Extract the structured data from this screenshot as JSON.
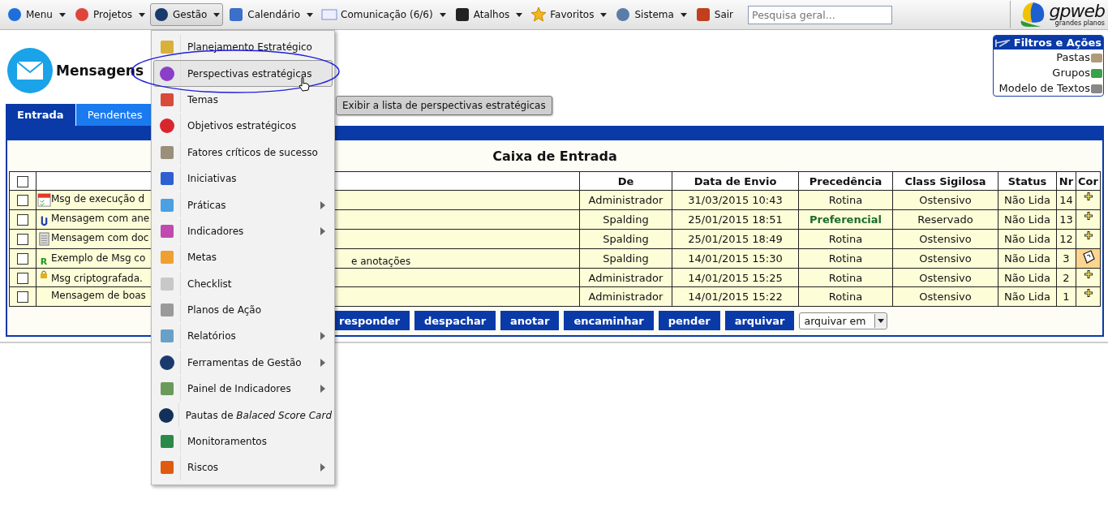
{
  "menu_bar": {
    "items": [
      {
        "label": "Menu",
        "kind": "drop",
        "caret": true,
        "selected": false
      },
      {
        "label": "Projetos",
        "kind": "puzzle",
        "caret": true,
        "selected": false
      },
      {
        "label": "Gestão",
        "kind": "globe",
        "caret": true,
        "selected": true
      },
      {
        "label": "Calendário",
        "kind": "calendar",
        "caret": true,
        "selected": false
      },
      {
        "label": "Comunicação (6/6)",
        "kind": "mail",
        "caret": true,
        "selected": false
      },
      {
        "label": "Atalhos",
        "kind": "shortcut",
        "caret": true,
        "selected": false
      },
      {
        "label": "Favoritos",
        "kind": "star",
        "caret": true,
        "selected": false
      },
      {
        "label": "Sistema",
        "kind": "tools",
        "caret": true,
        "selected": false
      },
      {
        "label": "Sair",
        "kind": "power",
        "caret": false,
        "selected": false
      }
    ],
    "search": {
      "placeholder": "Pesquisa geral..."
    },
    "logo": {
      "name": "gpweb",
      "tagline": "grandes planos"
    }
  },
  "page": {
    "title": "Mensagens"
  },
  "filters_panel": {
    "title": "Filtros e Ações",
    "items": [
      {
        "label": "Pastas",
        "kind": "folder"
      },
      {
        "label": "Grupos",
        "kind": "users"
      },
      {
        "label": "Modelo de Textos",
        "kind": "pen"
      }
    ]
  },
  "tabs": [
    {
      "label": "Entrada",
      "selected": true
    },
    {
      "label": "Pendentes",
      "selected": false
    }
  ],
  "inbox": {
    "title": "Caixa de Entrada",
    "header_checkbox": {
      "checked": false
    },
    "columns": [
      "De",
      "Data de Envio",
      "Precedência",
      "Class Sigilosa",
      "Status",
      "Nr",
      "Cor"
    ],
    "rows": [
      {
        "checked": false,
        "kind": "calendar",
        "subject": "Msg de execução d",
        "from": "Administrador",
        "date": "31/03/2015 10:43",
        "precedence": "Rotina",
        "highlighted": false,
        "classification": "Ostensivo",
        "status": "Não Lida",
        "nr": "14",
        "annotated": false
      },
      {
        "checked": false,
        "kind": "clip",
        "subject": "Mensagem com ane",
        "from": "Spalding",
        "date": "25/01/2015 18:51",
        "precedence": "Preferencial",
        "highlighted": true,
        "classification": "Reservado",
        "status": "Não Lida",
        "nr": "13",
        "annotated": false
      },
      {
        "checked": false,
        "kind": "doc",
        "subject": "Mensagem com doc",
        "from": "Spalding",
        "date": "25/01/2015 18:49",
        "precedence": "Rotina",
        "highlighted": false,
        "classification": "Ostensivo",
        "status": "Não Lida",
        "nr": "12",
        "annotated": false
      },
      {
        "checked": false,
        "kind": "reply",
        "icon_text": "R",
        "subject": "Exemplo de Msg co",
        "subject_tail": "e anotações",
        "from": "Spalding",
        "date": "14/01/2015 15:30",
        "precedence": "Rotina",
        "highlighted": false,
        "classification": "Ostensivo",
        "status": "Não Lida",
        "nr": "3",
        "annotated": true
      },
      {
        "checked": false,
        "kind": "lock",
        "subject": "Msg criptografada.",
        "from": "Administrador",
        "date": "14/01/2015 15:25",
        "precedence": "Rotina",
        "highlighted": false,
        "classification": "Ostensivo",
        "status": "Não Lida",
        "nr": "2",
        "annotated": false
      },
      {
        "checked": false,
        "kind": "plain",
        "subject": "Mensagem de boas",
        "from": "Administrador",
        "date": "14/01/2015 15:22",
        "precedence": "Rotina",
        "highlighted": false,
        "classification": "Ostensivo",
        "status": "Não Lida",
        "nr": "1",
        "annotated": false
      }
    ],
    "actions": [
      "responder",
      "despachar",
      "anotar",
      "encaminhar",
      "pender",
      "arquivar"
    ],
    "archive_select": {
      "value": "arquivar em"
    }
  },
  "dropdown": {
    "items": [
      {
        "label": "Planejamento Estratégico",
        "kind": "folder",
        "submenu": false,
        "selected": false
      },
      {
        "label": "Perspectivas estratégicas",
        "kind": "flower",
        "submenu": false,
        "selected": true
      },
      {
        "label": "Temas",
        "kind": "grid",
        "submenu": false,
        "selected": false
      },
      {
        "label": "Objetivos estratégicos",
        "kind": "target",
        "submenu": false,
        "selected": false
      },
      {
        "label": "Fatores críticos de sucesso",
        "kind": "key",
        "submenu": false,
        "selected": false
      },
      {
        "label": "Iniciativas",
        "kind": "trend",
        "submenu": false,
        "selected": false
      },
      {
        "label": "Práticas",
        "kind": "gear",
        "submenu": true,
        "selected": false
      },
      {
        "label": "Indicadores",
        "kind": "bars",
        "submenu": true,
        "selected": false
      },
      {
        "label": "Metas",
        "kind": "wave",
        "submenu": false,
        "selected": false
      },
      {
        "label": "Checklist",
        "kind": "list",
        "submenu": false,
        "selected": false
      },
      {
        "label": "Planos de Ação",
        "kind": "sheet",
        "submenu": false,
        "selected": false
      },
      {
        "label": "Relatórios",
        "kind": "report",
        "submenu": true,
        "selected": false
      },
      {
        "label": "Ferramentas de Gestão",
        "kind": "globe",
        "submenu": true,
        "selected": false
      },
      {
        "label": "Painel de Indicadores",
        "kind": "panel",
        "submenu": true,
        "selected": false
      },
      {
        "label": "Pautas de *Balaced Score Card*",
        "kind": "p",
        "submenu": false,
        "selected": false
      },
      {
        "label": "Monitoramentos",
        "kind": "monitor",
        "submenu": false,
        "selected": false
      },
      {
        "label": "Riscos",
        "kind": "fire",
        "submenu": true,
        "selected": false
      }
    ],
    "tooltip": "Exibir a lista de perspectivas estratégicas"
  }
}
